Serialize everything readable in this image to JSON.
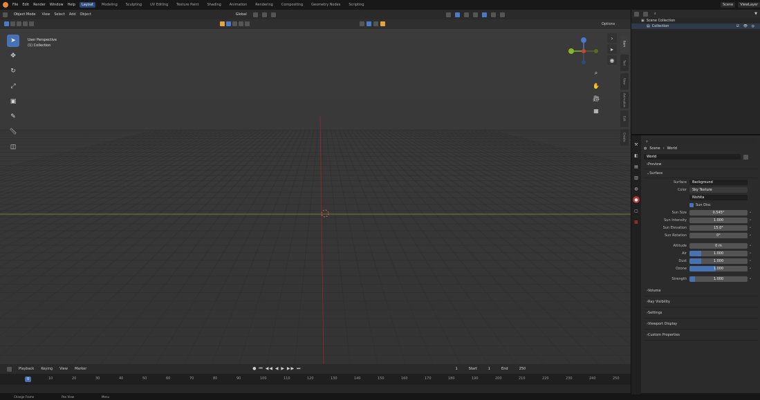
{
  "topbar": {
    "menus": [
      "File",
      "Edit",
      "Render",
      "Window",
      "Help"
    ],
    "tabs": [
      "Layout",
      "Modeling",
      "Sculpting",
      "UV Editing",
      "Texture Paint",
      "Shading",
      "Animation",
      "Rendering",
      "Compositing",
      "Geometry Nodes",
      "Scripting"
    ],
    "active_tab": "Layout",
    "scene": "Scene",
    "view_layer": "ViewLayer"
  },
  "viewport_header": {
    "mode": "Object Mode",
    "menus": [
      "View",
      "Select",
      "Add",
      "Object"
    ],
    "transform_orientation": "Global",
    "options_label": "Options"
  },
  "viewport": {
    "view_name": "User Perspective",
    "collection_info": "(1) Collection"
  },
  "tools": [
    "cursor",
    "move",
    "rotate",
    "scale",
    "transform",
    "annotate",
    "measure",
    "add-cube"
  ],
  "nav_tabs": [
    "Item",
    "Tool",
    "View",
    "Animation",
    "Edit",
    "Create"
  ],
  "timeline": {
    "menus": [
      "Playback",
      "Keying",
      "View",
      "Marker"
    ],
    "start_label": "Start",
    "start": "1",
    "end_label": "End",
    "end": "250",
    "current_frame": "1",
    "ruler": [
      "0",
      "10",
      "20",
      "30",
      "40",
      "50",
      "60",
      "70",
      "80",
      "90",
      "100",
      "110",
      "120",
      "130",
      "140",
      "150",
      "160",
      "170",
      "180",
      "190",
      "200",
      "210",
      "220",
      "230",
      "240",
      "250"
    ]
  },
  "statusbar": [
    "Change Frame",
    "Pan View",
    "Menu"
  ],
  "outliner": {
    "root": "Scene Collection",
    "child": "Collection"
  },
  "properties": {
    "breadcrumb_scene": "Scene",
    "breadcrumb_world": "World",
    "world_name": "World",
    "panels_top": [
      "Preview",
      "Surface"
    ],
    "surface": {
      "surface_label": "Surface",
      "surface_value": "Background",
      "color_label": "Color",
      "color_value": "Sky Texture",
      "sky_type": "Nishita",
      "sun_disc_label": "Sun Disc",
      "rows": [
        {
          "label": "Sun Size",
          "value": "0.545°"
        },
        {
          "label": "Sun Intensity",
          "value": "1.000"
        },
        {
          "label": "Sun Elevation",
          "value": "15.0°"
        },
        {
          "label": "Sun Rotation",
          "value": "0°"
        },
        {
          "label": "Altitude",
          "value": "0 m"
        }
      ],
      "sliders": [
        {
          "label": "Air",
          "value": "1.000",
          "fill": 0.2
        },
        {
          "label": "Dust",
          "value": "1.000",
          "fill": 0.2
        },
        {
          "label": "Ozone",
          "value": "1.000",
          "fill": 0.45
        },
        {
          "label": "Strength",
          "value": "1.000",
          "fill": 0.1
        }
      ]
    },
    "panels_bottom": [
      "Volume",
      "Ray Visibility",
      "Settings",
      "Viewport Display",
      "Custom Properties"
    ]
  },
  "colors": {
    "accent": "#4772b3",
    "x_axis": "#9a2a2a",
    "y_axis": "#8a9a2a",
    "blender_orange": "#e8873a"
  }
}
